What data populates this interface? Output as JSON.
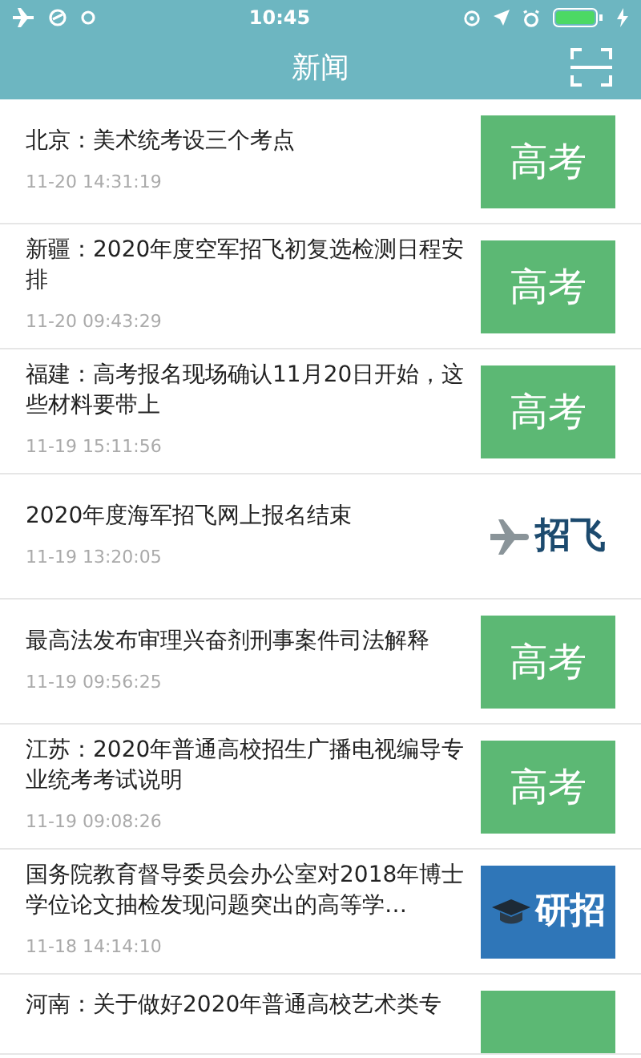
{
  "status_bar": {
    "time": "10:45"
  },
  "header": {
    "title": "新闻"
  },
  "news": [
    {
      "title": "北京：美术统考设三个考点",
      "time": "11-20 14:31:19",
      "tag": {
        "kind": "gaokao",
        "label": "高考"
      }
    },
    {
      "title": "新疆：2020年度空军招飞初复选检测日程安排",
      "time": "11-20 09:43:29",
      "tag": {
        "kind": "gaokao",
        "label": "高考"
      }
    },
    {
      "title": "福建：高考报名现场确认11月20日开始，这些材料要带上",
      "time": "11-19 15:11:56",
      "tag": {
        "kind": "gaokao",
        "label": "高考"
      }
    },
    {
      "title": "2020年度海军招飞网上报名结束",
      "time": "11-19 13:20:05",
      "tag": {
        "kind": "zhaofei",
        "label": "招飞"
      }
    },
    {
      "title": "最高法发布审理兴奋剂刑事案件司法解释",
      "time": "11-19 09:56:25",
      "tag": {
        "kind": "gaokao",
        "label": "高考"
      }
    },
    {
      "title": "江苏：2020年普通高校招生广播电视编导专业统考考试说明",
      "time": "11-19 09:08:26",
      "tag": {
        "kind": "gaokao",
        "label": "高考"
      }
    },
    {
      "title": "国务院教育督导委员会办公室对2018年博士学位论文抽检发现问题突出的高等学…",
      "time": "11-18 14:14:10",
      "tag": {
        "kind": "yanzhao",
        "label": "研招"
      }
    },
    {
      "title": "河南：关于做好2020年普通高校艺术类专",
      "tag": {
        "kind": "gaokao"
      }
    }
  ]
}
